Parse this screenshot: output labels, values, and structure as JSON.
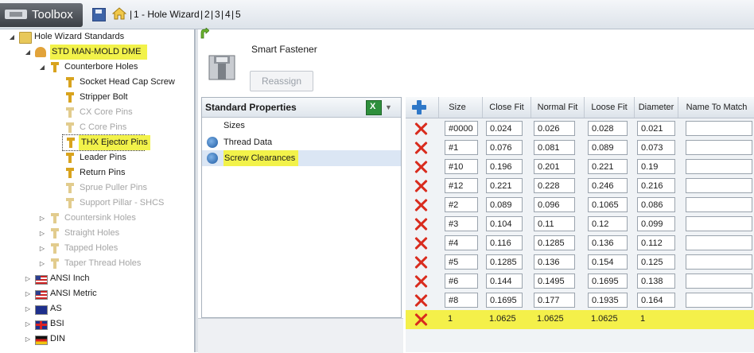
{
  "titlebar": {
    "app_title": "Toolbox",
    "breadcrumbs": [
      "1 - Hole Wizard",
      "2",
      "3",
      "4",
      "5"
    ]
  },
  "tree": {
    "root": "Hole Wizard Standards",
    "standard": "STD MAN-MOLD DME",
    "counterbore": "Counterbore Holes",
    "counterbore_items": [
      "Socket Head Cap Screw",
      "Stripper Bolt",
      "CX Core Pins",
      "C Core Pins",
      "THX Ejector Pins",
      "Leader Pins",
      "Return Pins",
      "Sprue Puller Pins",
      "Support Pillar - SHCS"
    ],
    "groups": [
      "Countersink Holes",
      "Straight Holes",
      "Tapped Holes",
      "Taper Thread Holes"
    ],
    "standards": [
      "ANSI Inch",
      "ANSI Metric",
      "AS",
      "BSI",
      "DIN"
    ]
  },
  "fastener": {
    "label": "Smart Fastener",
    "reassign": "Reassign"
  },
  "properties": {
    "title": "Standard Properties",
    "items": [
      "Sizes",
      "Thread Data",
      "Screw Clearances"
    ],
    "selected": "Screw Clearances"
  },
  "grid": {
    "columns": [
      "Size",
      "Close Fit",
      "Normal Fit",
      "Loose Fit",
      "Diameter",
      "Name To Match"
    ],
    "rows": [
      [
        "#0000",
        "0.024",
        "0.026",
        "0.028",
        "0.021",
        ""
      ],
      [
        "#1",
        "0.076",
        "0.081",
        "0.089",
        "0.073",
        ""
      ],
      [
        "#10",
        "0.196",
        "0.201",
        "0.221",
        "0.19",
        ""
      ],
      [
        "#12",
        "0.221",
        "0.228",
        "0.246",
        "0.216",
        ""
      ],
      [
        "#2",
        "0.089",
        "0.096",
        "0.1065",
        "0.086",
        ""
      ],
      [
        "#3",
        "0.104",
        "0.11",
        "0.12",
        "0.099",
        ""
      ],
      [
        "#4",
        "0.116",
        "0.1285",
        "0.136",
        "0.112",
        ""
      ],
      [
        "#5",
        "0.1285",
        "0.136",
        "0.154",
        "0.125",
        ""
      ],
      [
        "#6",
        "0.144",
        "0.1495",
        "0.1695",
        "0.138",
        ""
      ],
      [
        "#8",
        "0.1695",
        "0.177",
        "0.1935",
        "0.164",
        ""
      ],
      [
        "1",
        "1.0625",
        "1.0625",
        "1.0625",
        "1",
        ""
      ]
    ]
  },
  "colors": {
    "highlight": "#f2f24a",
    "delete": "#d92c1e",
    "add": "#2f78c8"
  }
}
